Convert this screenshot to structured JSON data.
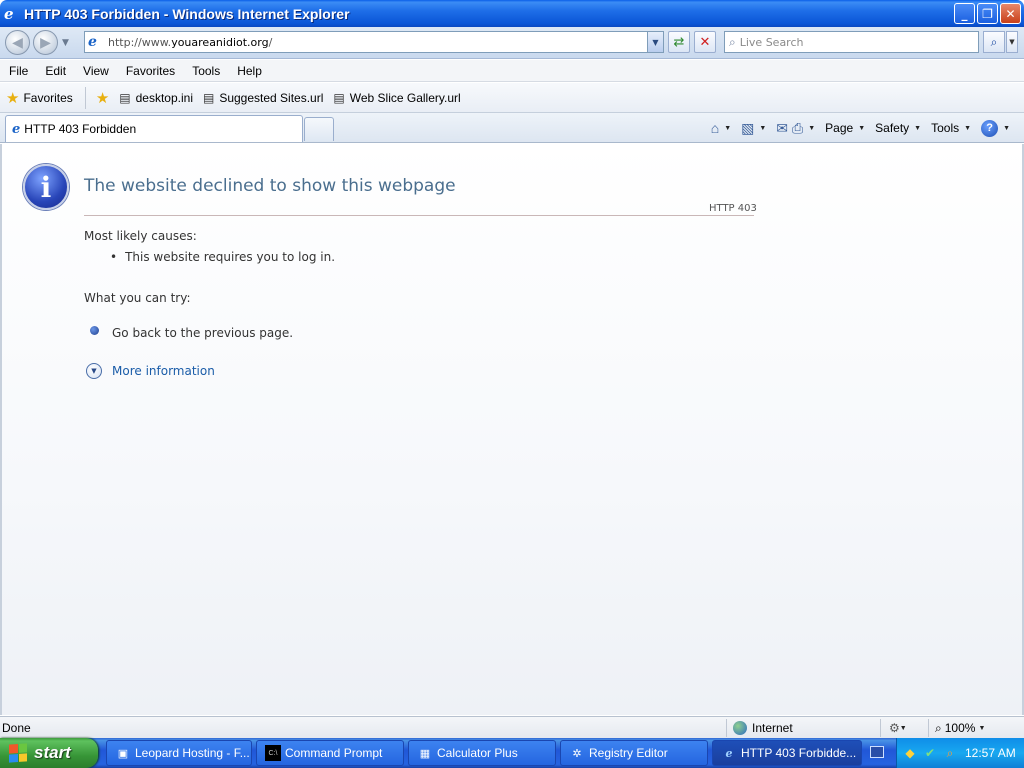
{
  "window": {
    "title": "HTTP 403 Forbidden - Windows Internet Explorer",
    "minimize_glyph": "_",
    "restore_glyph": "❐",
    "close_glyph": "✕"
  },
  "navigation": {
    "url_prefix": "http://www.",
    "url_domain": "youareanidiot.org",
    "url_suffix": "/",
    "search_placeholder": "Live Search"
  },
  "menu": {
    "items": [
      "File",
      "Edit",
      "View",
      "Favorites",
      "Tools",
      "Help"
    ]
  },
  "favorites_bar": {
    "favorites_label": "Favorites",
    "items": [
      "desktop.ini",
      "Suggested Sites.url",
      "Web Slice Gallery.url"
    ]
  },
  "tabs": {
    "active_label": "HTTP 403 Forbidden"
  },
  "command_bar": {
    "page_label": "Page",
    "safety_label": "Safety",
    "tools_label": "Tools"
  },
  "error_page": {
    "heading": "The website declined to show this webpage",
    "code": "HTTP 403",
    "causes_title": "Most likely causes:",
    "causes": [
      "This website requires you to log in."
    ],
    "try_title": "What you can try:",
    "try_items": [
      "Go back to the previous page."
    ],
    "more_info": "More information"
  },
  "status_bar": {
    "status": "Done",
    "zone": "Internet",
    "zoom": "100%"
  },
  "taskbar": {
    "start_label": "start",
    "items": [
      "Leopard Hosting - F...",
      "Command Prompt",
      "Calculator Plus",
      "Registry Editor",
      "HTTP 403 Forbidde..."
    ],
    "clock": "12:57 AM"
  },
  "colors": {
    "titlebar_blue": "#0a55d6",
    "heading_text": "#4a6e8e",
    "link_blue": "#1a5ca8",
    "start_green": "#379537"
  }
}
